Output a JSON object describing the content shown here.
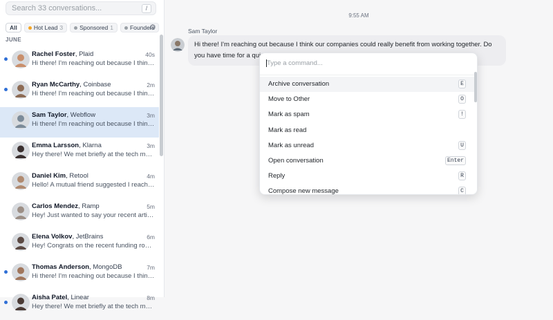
{
  "sidebar": {
    "search_placeholder": "Search 33 conversations...",
    "search_shortcut": "/",
    "filters": [
      {
        "label": "All",
        "count": "",
        "color": ""
      },
      {
        "label": "Hot Lead",
        "count": "3",
        "color": "#f5a524"
      },
      {
        "label": "Sponsored",
        "count": "1",
        "color": "#9aa0a6"
      },
      {
        "label": "Founders",
        "count": "",
        "color": "#9aa0a6"
      }
    ],
    "section_label": "JUNE",
    "conversations": [
      {
        "name": "Rachel Foster",
        "company": "Plaid",
        "time": "40s",
        "preview": "Hi there! I'm reaching out because I think our companies",
        "unread": true,
        "avatar": "#c98f6c"
      },
      {
        "name": "Ryan McCarthy",
        "company": "Coinbase",
        "time": "2m",
        "preview": "Hi there! I'm reaching out because I think our companies",
        "unread": true,
        "avatar": "#8d6b54"
      },
      {
        "name": "Sam Taylor",
        "company": "Webflow",
        "time": "3m",
        "preview": "Hi there! I'm reaching out because I think our companies",
        "unread": false,
        "avatar": "#7c8b99"
      },
      {
        "name": "Emma Larsson",
        "company": "Klarna",
        "time": "3m",
        "preview": "Hey there! We met briefly at the tech meetup last week",
        "unread": false,
        "avatar": "#3a3030"
      },
      {
        "name": "Daniel Kim",
        "company": "Retool",
        "time": "4m",
        "preview": "Hello! A mutual friend suggested I reach out to you",
        "unread": false,
        "avatar": "#b08a70"
      },
      {
        "name": "Carlos Mendez",
        "company": "Ramp",
        "time": "5m",
        "preview": "Hey! Just wanted to say your recent article was great",
        "unread": false,
        "avatar": "#9c8f86"
      },
      {
        "name": "Elena Volkov",
        "company": "JetBrains",
        "time": "6m",
        "preview": "Hey! Congrats on the recent funding round and growth",
        "unread": false,
        "avatar": "#5b4a44"
      },
      {
        "name": "Thomas Anderson",
        "company": "MongoDB",
        "time": "7m",
        "preview": "Hi there! I'm reaching out because I think our companies",
        "unread": true,
        "avatar": "#a0765c"
      },
      {
        "name": "Aisha Patel",
        "company": "Linear",
        "time": "8m",
        "preview": "Hey there! We met briefly at the tech meetup last week",
        "unread": true,
        "avatar": "#4a3a35"
      }
    ]
  },
  "main": {
    "timestamp": "9:55 AM",
    "sender": "Sam Taylor",
    "message": "Hi there! I'm reaching out because I think our companies could really benefit from working together. Do you have time for a quick chat this week?"
  },
  "palette": {
    "placeholder": "Type a command...",
    "commands": [
      {
        "label": "Archive conversation",
        "key": "E"
      },
      {
        "label": "Move to Other",
        "key": "O"
      },
      {
        "label": "Mark as spam",
        "key": "!"
      },
      {
        "label": "Mark as read",
        "key": ""
      },
      {
        "label": "Mark as unread",
        "key": "U"
      },
      {
        "label": "Open conversation",
        "key": "Enter"
      },
      {
        "label": "Reply",
        "key": "R"
      },
      {
        "label": "Compose new message",
        "key": "C"
      }
    ]
  },
  "colors": {
    "accent": "#2f6fd6",
    "selected_row": "#dce8f7"
  }
}
